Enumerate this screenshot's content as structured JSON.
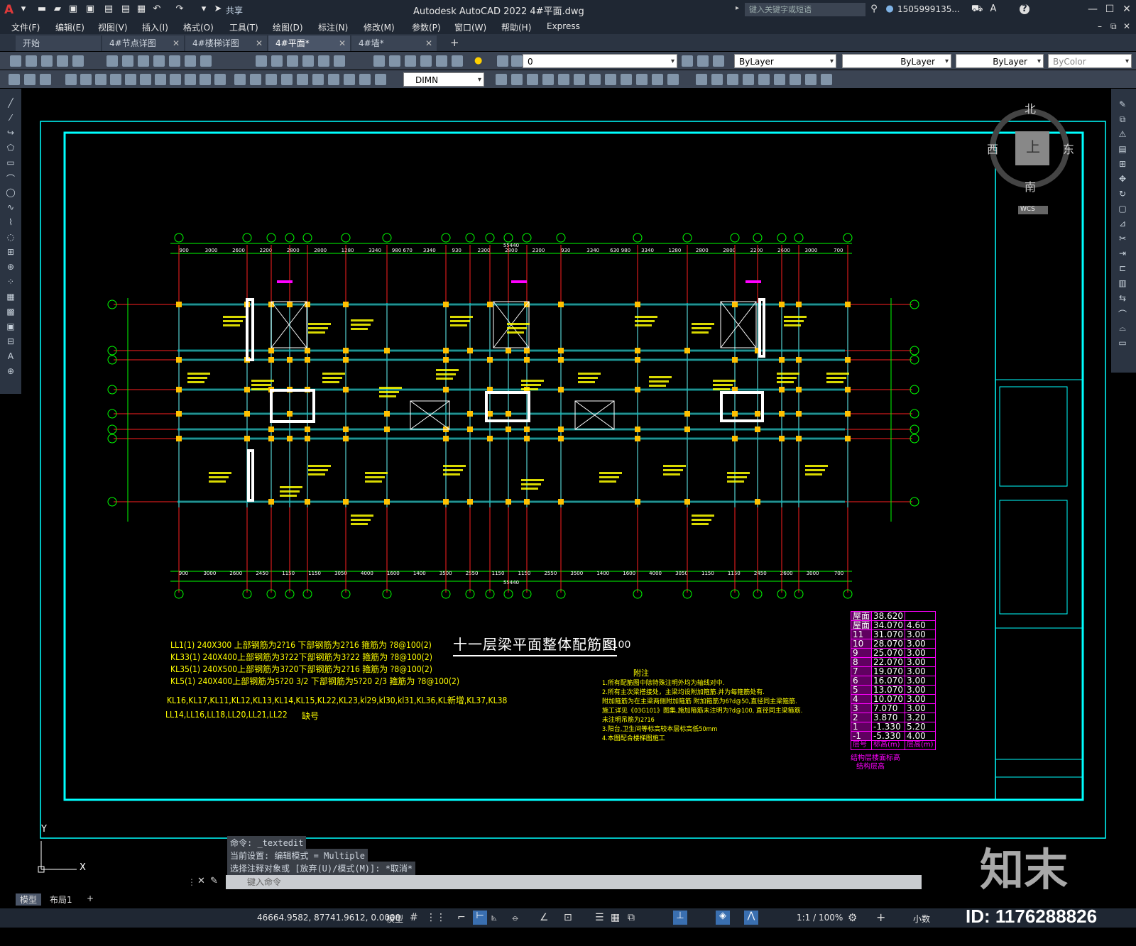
{
  "window": {
    "title": "Autodesk AutoCAD 2022    4#平面.dwg",
    "share_label": "共享",
    "search_placeholder": "键入关键字或短语",
    "user": "1505999135...",
    "help": "?"
  },
  "menu": [
    "文件(F)",
    "编辑(E)",
    "视图(V)",
    "插入(I)",
    "格式(O)",
    "工具(T)",
    "绘图(D)",
    "标注(N)",
    "修改(M)",
    "参数(P)",
    "窗口(W)",
    "帮助(H)",
    "Express"
  ],
  "tabs": [
    {
      "label": "开始",
      "active": false
    },
    {
      "label": "4#节点详图",
      "active": false
    },
    {
      "label": "4#楼梯详图",
      "active": false
    },
    {
      "label": "4#平面*",
      "active": true
    },
    {
      "label": "4#墙*",
      "active": false
    }
  ],
  "toolbar": {
    "layer_value": "0",
    "color_value": "ByLayer",
    "linetype_value": "ByLayer",
    "lineweight_value": "ByLayer",
    "plotstyle_value": "ByColor",
    "dimstyle_value": "DIMN"
  },
  "viewcube": {
    "north": "北",
    "south": "南",
    "west": "西",
    "east": "东",
    "top": "上",
    "wcs": "WCS"
  },
  "drawing": {
    "title": "十一层梁平面整体配筋图",
    "scale_suffix": "1:100",
    "dim_total": "55440",
    "top_dims": [
      "900",
      "3000",
      "2600",
      "2200",
      "2800",
      "2800",
      "1280",
      "3340",
      "980 670",
      "3340",
      "930",
      "2300",
      "2800",
      "2300",
      "930",
      "3340",
      "630 980",
      "3340",
      "1280",
      "2800",
      "2800",
      "2200",
      "2600",
      "3000",
      "700"
    ],
    "bottom_dims": [
      "900",
      "3000",
      "2600",
      "2450",
      "1150",
      "1150",
      "3050",
      "4000",
      "1600",
      "1400",
      "3500",
      "2550",
      "1150",
      "1150",
      "2550",
      "3500",
      "1400",
      "1600",
      "4000",
      "3050",
      "1150",
      "1150",
      "2450",
      "2600",
      "3000",
      "700"
    ],
    "notes_left": [
      "LL1(1) 240X300 上部钢筋为2?16 下部钢筋为2?16 箍筋为 ?8@100(2)",
      "KL33(1) 240X400上部钢筋为3?22下部钢筋为3?22 箍筋为 ?8@100(2)",
      "KL35(1) 240X500上部钢筋为3?20下部钢筋为2?16 箍筋为 ?8@100(2)",
      "KL5(1) 240X400上部钢筋为5?20 3/2 下部钢筋为5?20 2/3 箍筋为 ?8@100(2)",
      "KL16,KL17,KL11,KL12,KL13,KL14,KL15,KL22,KL23,kl29,kl30,kl31,KL36,KL新增,KL37,KL38",
      "LL14,LL16,LL18,LL20,LL21,LL22"
    ],
    "missing_label": "缺号",
    "notes_title": "附注",
    "notes_right": [
      "1.所有配筋图中除特殊注明外均为轴线对中.",
      "2.所有主次梁搭接处，主梁均设附加箍筋.并为每箍筋处有.",
      "   附加箍筋为在主梁两侧附加箍筋 附加箍筋为6?d@50,直径同主梁箍筋.",
      "   施工详见《03G101》图集,施加箍筋未注明为?d@100, 直径同主梁箍筋.",
      "   未注明吊筋为2?16",
      "3.阳台,卫生间等标高较本层标高低50mm",
      "4.本图配合楼梯图施工"
    ],
    "floor_table": {
      "rows": [
        [
          "屋面",
          "38.620",
          ""
        ],
        [
          "屋面",
          "34.070",
          "4.60"
        ],
        [
          "11",
          "31.070",
          "3.00"
        ],
        [
          "10",
          "28.070",
          "3.00"
        ],
        [
          "9",
          "25.070",
          "3.00"
        ],
        [
          "8",
          "22.070",
          "3.00"
        ],
        [
          "7",
          "19.070",
          "3.00"
        ],
        [
          "6",
          "16.070",
          "3.00"
        ],
        [
          "5",
          "13.070",
          "3.00"
        ],
        [
          "4",
          "10.070",
          "3.00"
        ],
        [
          "3",
          "7.070",
          "3.00"
        ],
        [
          "2",
          "3.870",
          "3.20"
        ],
        [
          "1",
          "-1.330",
          "5.20"
        ],
        [
          "-1",
          "-5.330",
          "4.00"
        ]
      ],
      "footer": [
        "层号",
        "标高(m)",
        "层高(m)"
      ],
      "caption": "结构层楼面标高",
      "caption2": "结构层高"
    }
  },
  "command": {
    "history": [
      "命令: _textedit",
      "当前设置: 编辑模式 = Multiple",
      "选择注释对象或 [放弃(U)/模式(M)]: *取消*"
    ],
    "placeholder": "键入命令"
  },
  "layouts": [
    "模型",
    "布局1"
  ],
  "status": {
    "coords": "46664.9582, 87741.9612, 0.0000",
    "mode": "模型",
    "scale": "1:1 / 100%",
    "units": "小数"
  },
  "watermark": {
    "brand": "知末",
    "id": "ID: 1176288826"
  }
}
